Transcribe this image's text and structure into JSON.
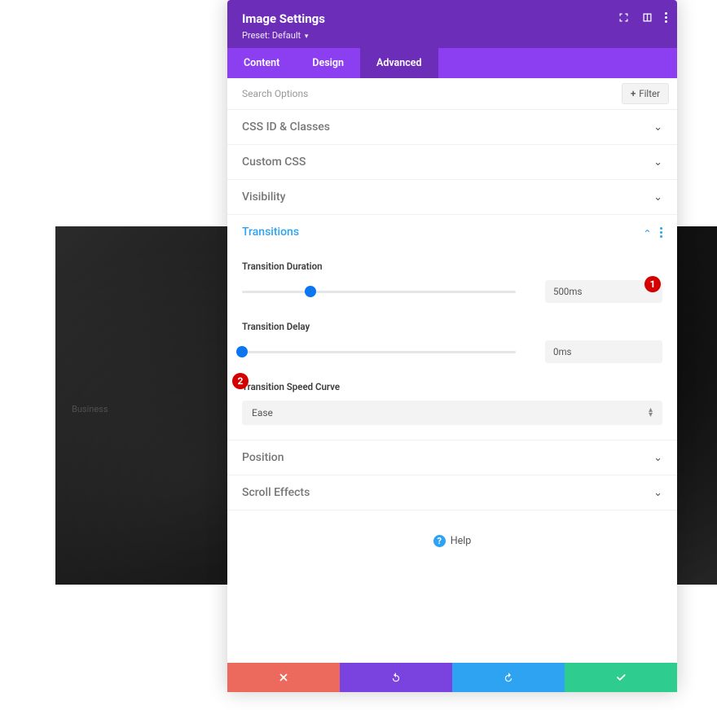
{
  "header": {
    "title": "Image Settings",
    "preset_label": "Preset: Default"
  },
  "tabs": {
    "content": "Content",
    "design": "Design",
    "advanced": "Advanced"
  },
  "search": {
    "placeholder": "Search Options",
    "filter_label": "Filter"
  },
  "sections": {
    "css_id": "CSS ID & Classes",
    "custom_css": "Custom CSS",
    "visibility": "Visibility",
    "transitions": "Transitions",
    "position": "Position",
    "scroll_effects": "Scroll Effects"
  },
  "transitions": {
    "duration_label": "Transition Duration",
    "duration_value": "500ms",
    "duration_percent": 25,
    "delay_label": "Transition Delay",
    "delay_value": "0ms",
    "delay_percent": 0,
    "speed_curve_label": "Transition Speed Curve",
    "speed_curve_value": "Ease"
  },
  "help_label": "Help",
  "bg_watermark": "Business",
  "annotations": {
    "one": "1",
    "two": "2"
  }
}
